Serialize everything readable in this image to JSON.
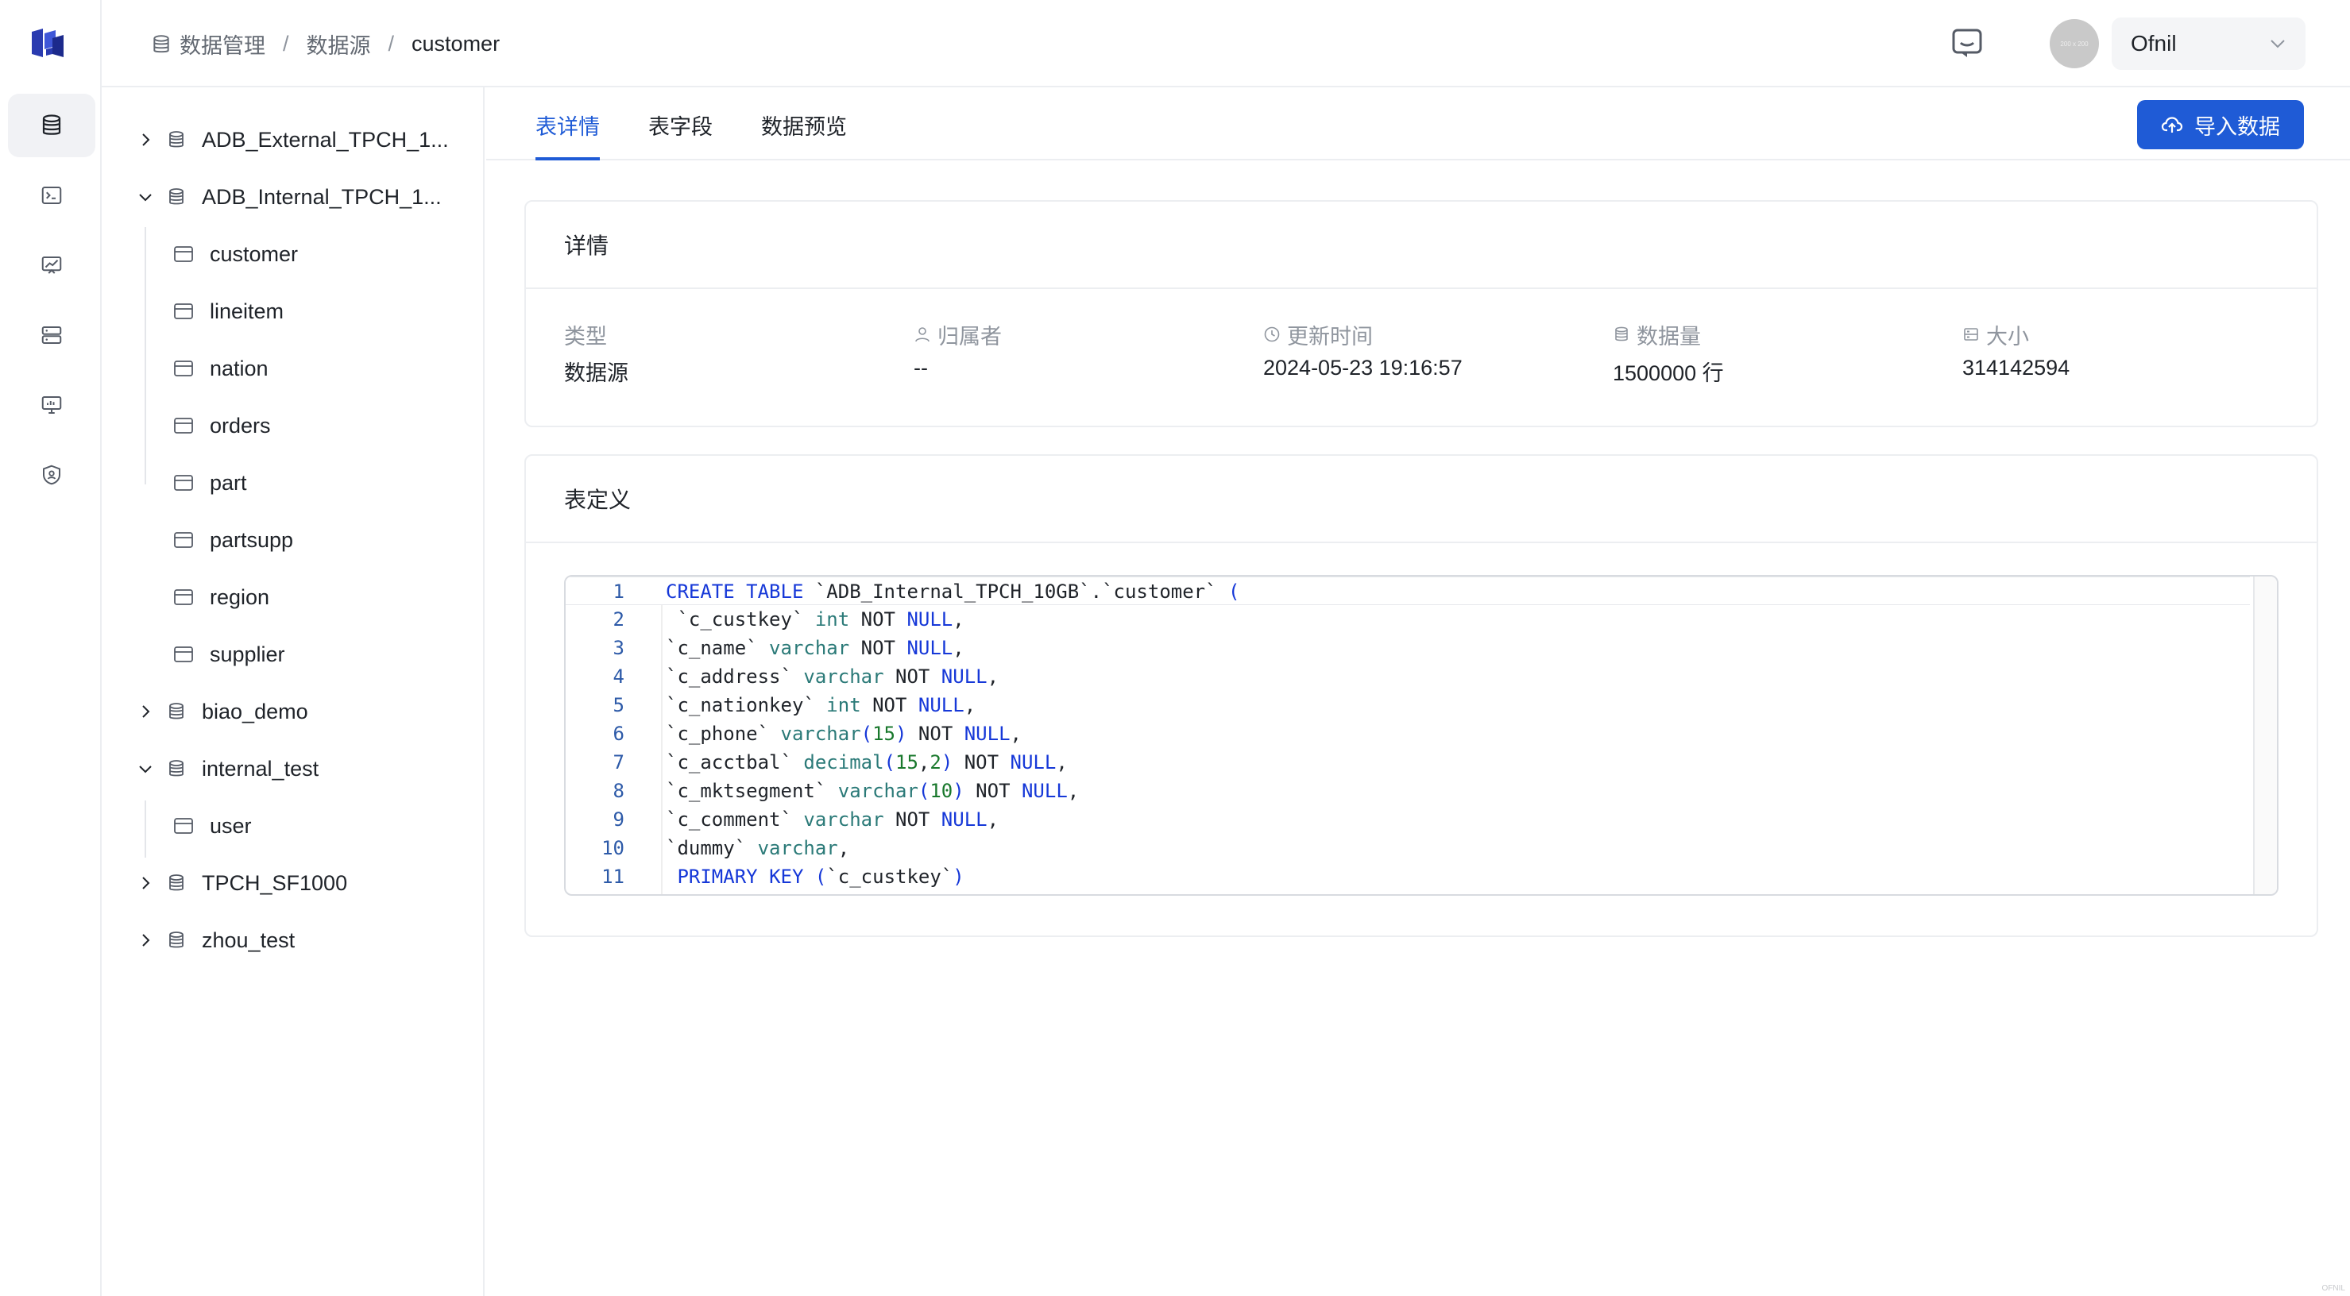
{
  "breadcrumb": {
    "root": "数据管理",
    "sep1": "/",
    "middle": "数据源",
    "sep2": "/",
    "current": "customer"
  },
  "header": {
    "avatar_text": "200 x 200",
    "user_name": "Ofnil"
  },
  "nav_icons": [
    "database-icon",
    "terminal-icon",
    "chart-icon",
    "server-icon",
    "monitor-icon",
    "shield-icon"
  ],
  "tree": {
    "items": [
      {
        "label": "ADB_External_TPCH_1...",
        "type": "database",
        "expanded": false
      },
      {
        "label": "ADB_Internal_TPCH_1...",
        "type": "database",
        "expanded": true
      },
      {
        "label": "customer",
        "type": "table"
      },
      {
        "label": "lineitem",
        "type": "table"
      },
      {
        "label": "nation",
        "type": "table"
      },
      {
        "label": "orders",
        "type": "table"
      },
      {
        "label": "part",
        "type": "table"
      },
      {
        "label": "partsupp",
        "type": "table"
      },
      {
        "label": "region",
        "type": "table"
      },
      {
        "label": "supplier",
        "type": "table"
      },
      {
        "label": "biao_demo",
        "type": "database",
        "expanded": false
      },
      {
        "label": "internal_test",
        "type": "database",
        "expanded": true
      },
      {
        "label": "user",
        "type": "table"
      },
      {
        "label": "TPCH_SF1000",
        "type": "database",
        "expanded": false
      },
      {
        "label": "zhou_test",
        "type": "database",
        "expanded": false
      }
    ]
  },
  "tabs": [
    {
      "label": "表详情",
      "active": true
    },
    {
      "label": "表字段",
      "active": false
    },
    {
      "label": "数据预览",
      "active": false
    }
  ],
  "import_button": "导入数据",
  "details": {
    "title": "详情",
    "fields": [
      {
        "label": "类型",
        "value": "数据源",
        "icon": ""
      },
      {
        "label": "归属者",
        "value": "--",
        "icon": "user-icon"
      },
      {
        "label": "更新时间",
        "value": "2024-05-23 19:16:57",
        "icon": "clock-icon"
      },
      {
        "label": "数据量",
        "value": "1500000 行",
        "icon": "database-icon"
      },
      {
        "label": "大小",
        "value": "314142594",
        "icon": "storage-icon"
      }
    ]
  },
  "definition": {
    "title": "表定义",
    "lines": [
      {
        "n": "1",
        "text": "CREATE TABLE `ADB_Internal_TPCH_10GB`.`customer` ("
      },
      {
        "n": "2",
        "text": " `c_custkey` int NOT NULL,"
      },
      {
        "n": "3",
        "text": "`c_name` varchar NOT NULL,"
      },
      {
        "n": "4",
        "text": "`c_address` varchar NOT NULL,"
      },
      {
        "n": "5",
        "text": "`c_nationkey` int NOT NULL,"
      },
      {
        "n": "6",
        "text": "`c_phone` varchar(15) NOT NULL,"
      },
      {
        "n": "7",
        "text": "`c_acctbal` decimal(15,2) NOT NULL,"
      },
      {
        "n": "8",
        "text": "`c_mktsegment` varchar(10) NOT NULL,"
      },
      {
        "n": "9",
        "text": "`c_comment` varchar NOT NULL,"
      },
      {
        "n": "10",
        "text": "`dummy` varchar,"
      },
      {
        "n": "11",
        "text": " PRIMARY KEY (`c_custkey`)"
      }
    ]
  },
  "watermark": "OFNIL",
  "colors": {
    "accent": "#1f5bd6",
    "keyword": "#1638d8",
    "type": "#2b7a78",
    "number": "#19782c"
  }
}
